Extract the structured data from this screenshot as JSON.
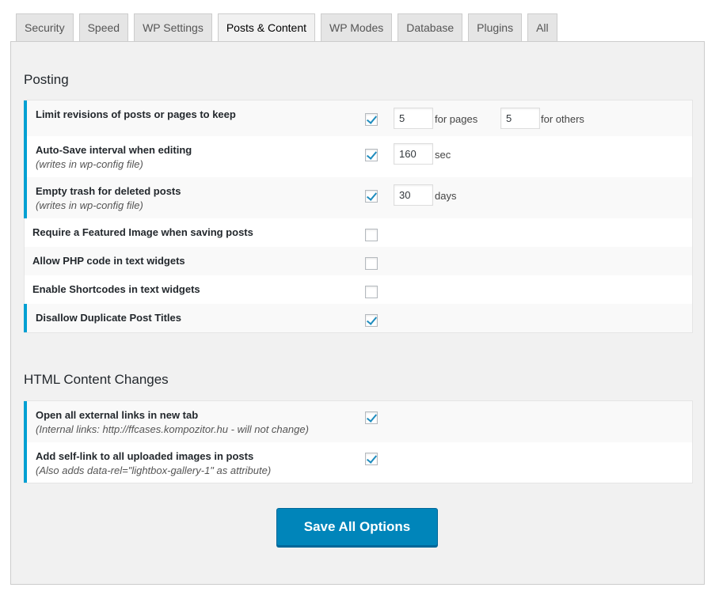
{
  "tabs": [
    {
      "label": "Security"
    },
    {
      "label": "Speed"
    },
    {
      "label": "WP Settings"
    },
    {
      "label": "Posts & Content",
      "active": true
    },
    {
      "label": "WP Modes"
    },
    {
      "label": "Database"
    },
    {
      "label": "Plugins"
    },
    {
      "label": "All"
    }
  ],
  "posting": {
    "title": "Posting",
    "rows": [
      {
        "label": "Limit revisions of posts or pages to keep",
        "checked": true,
        "pages_value": "5",
        "pages_unit": "for pages",
        "others_value": "5",
        "others_unit": "for others"
      },
      {
        "label": "Auto-Save interval when editing",
        "note": "(writes in wp-config file)",
        "checked": true,
        "value": "160",
        "unit": "sec"
      },
      {
        "label": "Empty trash for deleted posts",
        "note": "(writes in wp-config file)",
        "checked": true,
        "value": "30",
        "unit": "days"
      },
      {
        "label": "Require a Featured Image when saving posts",
        "checked": false
      },
      {
        "label": "Allow PHP code in text widgets",
        "checked": false
      },
      {
        "label": "Enable Shortcodes in text widgets",
        "checked": false
      },
      {
        "label": "Disallow Duplicate Post Titles",
        "checked": true
      }
    ]
  },
  "html_changes": {
    "title": "HTML Content Changes",
    "rows": [
      {
        "label": "Open all external links in new tab",
        "note": "(Internal links: http://ffcases.kompozitor.hu - will not change)",
        "checked": true
      },
      {
        "label": "Add self-link to all uploaded images in posts",
        "note": "(Also adds data-rel=\"lightbox-gallery-1\" as attribute)",
        "checked": true
      }
    ]
  },
  "save_label": "Save All Options",
  "accent_color": "#00a0d2",
  "button_color": "#0085ba"
}
